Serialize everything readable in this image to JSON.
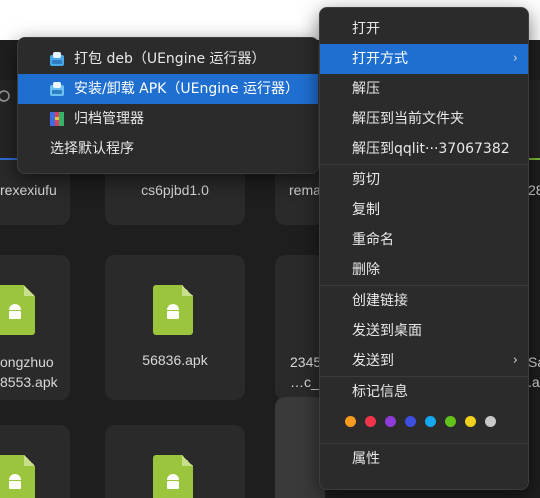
{
  "background": {
    "tiles": [
      {
        "label": "rexexiufu"
      },
      {
        "label": "cs6pjbd1.0"
      },
      {
        "label": "rema"
      },
      {
        "label": "ongzhuo\n8553.apk"
      },
      {
        "label": "56836.apk"
      },
      {
        "label": "2345\n…c_"
      },
      {
        "label": "Sa\n.a"
      },
      {
        "label": "28"
      }
    ]
  },
  "submenu": {
    "items": [
      {
        "label": "打包 deb（UEngine 运行器）",
        "icon": "uengine-icon"
      },
      {
        "label": "安装/卸载 APK（UEngine 运行器）",
        "icon": "uengine-icon"
      },
      {
        "label": "归档管理器",
        "icon": "archive-manager-icon"
      },
      {
        "label": "选择默认程序",
        "icon": ""
      }
    ]
  },
  "context_menu": {
    "open": "打开",
    "open_with": "打开方式",
    "extract": "解压",
    "extract_here": "解压到当前文件夹",
    "extract_to": "解压到qqlit···37067382",
    "cut": "剪切",
    "copy": "复制",
    "rename": "重命名",
    "delete": "删除",
    "create_link": "创建链接",
    "send_to_desktop": "发送到桌面",
    "send_to": "发送到",
    "tag_info": "标记信息",
    "properties": "属性",
    "tag_colors": [
      "#f59b1d",
      "#f2344a",
      "#8e3bd8",
      "#3c4fe0",
      "#15a7ef",
      "#62c31b",
      "#f0d21c",
      "#c9c9c9"
    ]
  }
}
